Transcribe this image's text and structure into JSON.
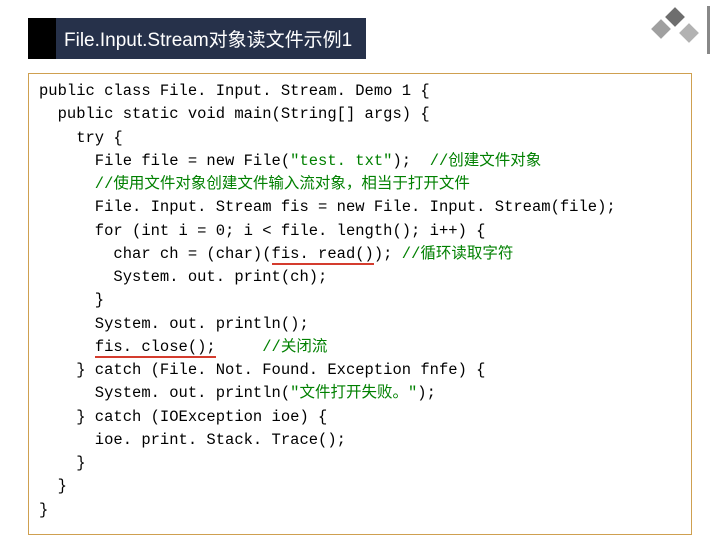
{
  "title": "File.Input.Stream对象读文件示例1",
  "code": {
    "l1a": "public class File. Input. Stream. Demo 1 {",
    "l2a": "  public static void main(String[] args) {",
    "l3a": "    try {",
    "l4a": "      File file = new File(",
    "l4s": "\"test. txt\"",
    "l4b": ");  ",
    "l4c": "//创建文件对象",
    "l5c": "      //使用文件对象创建文件输入流对象，相当于打开文件",
    "l6a": "      File. Input. Stream fis = new File. Input. Stream(file);",
    "l7a": "      for (int i = 0; i < file. length(); i++) {",
    "l8a": "        char ch = (char)(",
    "l8u": "fis. read()",
    "l8b": "); ",
    "l8c": "//循环读取字符",
    "l9a": "        System. out. print(ch);",
    "l10a": "      }",
    "l11a": "      System. out. println();",
    "l12a": "      ",
    "l12u": "fis. close();",
    "l12b": "     ",
    "l12c": "//关闭流",
    "l13a": "    } catch (File. Not. Found. Exception fnfe) {",
    "l14a": "      System. out. println(",
    "l14s": "\"文件打开失败。\"",
    "l14b": ");",
    "l15a": "    } catch (IOException ioe) {",
    "l16a": "      ioe. print. Stack. Trace();",
    "l17a": "    }",
    "l18a": "  }",
    "l19a": "}"
  }
}
